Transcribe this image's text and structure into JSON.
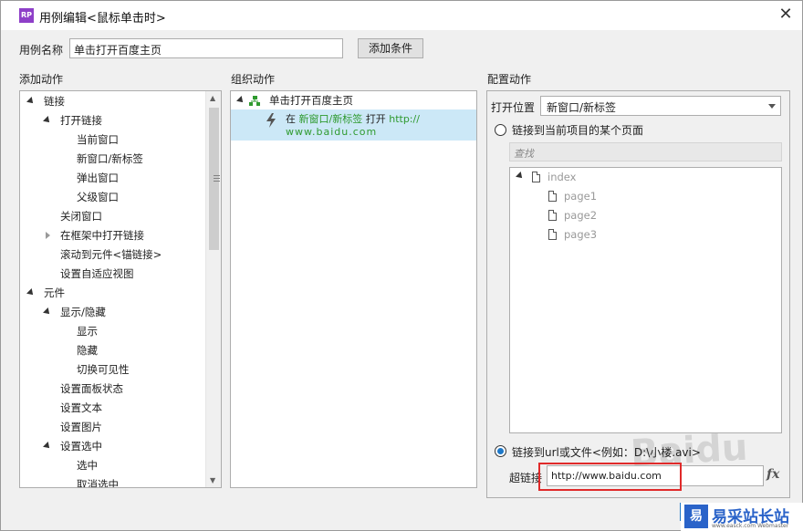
{
  "window": {
    "app_icon": "RP",
    "title": "用例编辑<鼠标单击时>",
    "close": "✕"
  },
  "case": {
    "name_label": "用例名称",
    "name_value": "单击打开百度主页",
    "add_condition": "添加条件"
  },
  "add_actions": {
    "header": "添加动作",
    "tree": [
      {
        "label": "链接",
        "level": 0,
        "expander": "down"
      },
      {
        "label": "打开链接",
        "level": 1,
        "expander": "down"
      },
      {
        "label": "当前窗口",
        "level": 2,
        "expander": ""
      },
      {
        "label": "新窗口/新标签",
        "level": 2,
        "expander": ""
      },
      {
        "label": "弹出窗口",
        "level": 2,
        "expander": ""
      },
      {
        "label": "父级窗口",
        "level": 2,
        "expander": ""
      },
      {
        "label": "关闭窗口",
        "level": 1,
        "expander": ""
      },
      {
        "label": "在框架中打开链接",
        "level": 1,
        "expander": "right"
      },
      {
        "label": "滚动到元件<锚链接>",
        "level": 1,
        "expander": ""
      },
      {
        "label": "设置自适应视图",
        "level": 1,
        "expander": ""
      },
      {
        "label": "元件",
        "level": 0,
        "expander": "down"
      },
      {
        "label": "显示/隐藏",
        "level": 1,
        "expander": "down"
      },
      {
        "label": "显示",
        "level": 2,
        "expander": ""
      },
      {
        "label": "隐藏",
        "level": 2,
        "expander": ""
      },
      {
        "label": "切换可见性",
        "level": 2,
        "expander": ""
      },
      {
        "label": "设置面板状态",
        "level": 1,
        "expander": ""
      },
      {
        "label": "设置文本",
        "level": 1,
        "expander": ""
      },
      {
        "label": "设置图片",
        "level": 1,
        "expander": ""
      },
      {
        "label": "设置选中",
        "level": 1,
        "expander": "down"
      },
      {
        "label": "选中",
        "level": 2,
        "expander": ""
      },
      {
        "label": "取消选中",
        "level": 2,
        "expander": ""
      }
    ]
  },
  "organize_actions": {
    "header": "组织动作",
    "case_name": "单击打开百度主页",
    "action_prefix": "在",
    "action_target": "新窗口/新标签",
    "action_verb": "打开",
    "action_url_part1": "http://",
    "action_url_part2": "www.baidu.com"
  },
  "configure_actions": {
    "header": "配置动作",
    "open_position_label": "打开位置",
    "open_position_value": "新窗口/新标签",
    "radio_page_label": "链接到当前项目的某个页面",
    "search_placeholder": "查找",
    "pages": [
      {
        "label": "index",
        "level": 0
      },
      {
        "label": "page1",
        "level": 1
      },
      {
        "label": "page2",
        "level": 1
      },
      {
        "label": "page3",
        "level": 1
      }
    ],
    "radio_url_label": "链接到url或文件<例如：D:\\小楼.avi>",
    "hyperlink_label": "超链接",
    "hyperlink_value": "http://www.baidu.com",
    "fx": "fx"
  },
  "brand": {
    "logo": "易",
    "name": "易采站长站",
    "url": "www.easck.com Webmaster"
  },
  "watermark": "Baidu"
}
